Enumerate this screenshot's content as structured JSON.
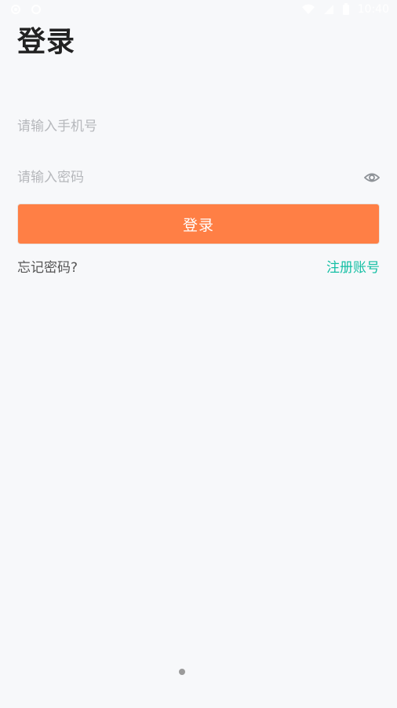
{
  "status_bar": {
    "time": "10:40",
    "left_icons": [
      "settings-gear-icon",
      "sync-icon"
    ],
    "right_icons": [
      "wifi-icon",
      "signal-icon",
      "battery-icon"
    ]
  },
  "page": {
    "title": "登录"
  },
  "form": {
    "phone_placeholder": "请输入手机号",
    "password_placeholder": "请输入密码",
    "login_label": "登录",
    "forgot_label": "忘记密码?",
    "register_label": "注册账号"
  },
  "colors": {
    "background": "#f7f8fa",
    "accent": "#ff7f45",
    "link": "#15bfa4",
    "placeholder": "#b6b8bc"
  }
}
